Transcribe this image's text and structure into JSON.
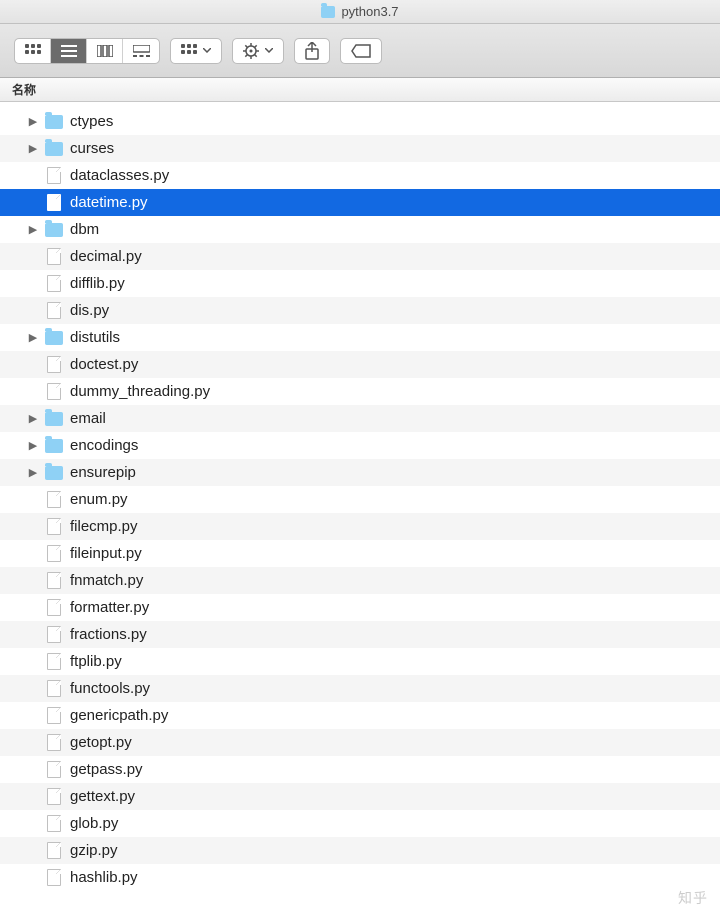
{
  "window": {
    "title": "python3.7"
  },
  "columns": {
    "name": "名称"
  },
  "watermark": "知乎",
  "items": [
    {
      "name": "",
      "type": "file",
      "expandable": false,
      "selected": false,
      "partial": true
    },
    {
      "name": "ctypes",
      "type": "folder",
      "expandable": true,
      "selected": false
    },
    {
      "name": "curses",
      "type": "folder",
      "expandable": true,
      "selected": false
    },
    {
      "name": "dataclasses.py",
      "type": "file",
      "expandable": false,
      "selected": false
    },
    {
      "name": "datetime.py",
      "type": "file",
      "expandable": false,
      "selected": true
    },
    {
      "name": "dbm",
      "type": "folder",
      "expandable": true,
      "selected": false
    },
    {
      "name": "decimal.py",
      "type": "file",
      "expandable": false,
      "selected": false
    },
    {
      "name": "difflib.py",
      "type": "file",
      "expandable": false,
      "selected": false
    },
    {
      "name": "dis.py",
      "type": "file",
      "expandable": false,
      "selected": false
    },
    {
      "name": "distutils",
      "type": "folder",
      "expandable": true,
      "selected": false
    },
    {
      "name": "doctest.py",
      "type": "file",
      "expandable": false,
      "selected": false
    },
    {
      "name": "dummy_threading.py",
      "type": "file",
      "expandable": false,
      "selected": false
    },
    {
      "name": "email",
      "type": "folder",
      "expandable": true,
      "selected": false
    },
    {
      "name": "encodings",
      "type": "folder",
      "expandable": true,
      "selected": false
    },
    {
      "name": "ensurepip",
      "type": "folder",
      "expandable": true,
      "selected": false
    },
    {
      "name": "enum.py",
      "type": "file",
      "expandable": false,
      "selected": false
    },
    {
      "name": "filecmp.py",
      "type": "file",
      "expandable": false,
      "selected": false
    },
    {
      "name": "fileinput.py",
      "type": "file",
      "expandable": false,
      "selected": false
    },
    {
      "name": "fnmatch.py",
      "type": "file",
      "expandable": false,
      "selected": false
    },
    {
      "name": "formatter.py",
      "type": "file",
      "expandable": false,
      "selected": false
    },
    {
      "name": "fractions.py",
      "type": "file",
      "expandable": false,
      "selected": false
    },
    {
      "name": "ftplib.py",
      "type": "file",
      "expandable": false,
      "selected": false
    },
    {
      "name": "functools.py",
      "type": "file",
      "expandable": false,
      "selected": false
    },
    {
      "name": "genericpath.py",
      "type": "file",
      "expandable": false,
      "selected": false
    },
    {
      "name": "getopt.py",
      "type": "file",
      "expandable": false,
      "selected": false
    },
    {
      "name": "getpass.py",
      "type": "file",
      "expandable": false,
      "selected": false
    },
    {
      "name": "gettext.py",
      "type": "file",
      "expandable": false,
      "selected": false
    },
    {
      "name": "glob.py",
      "type": "file",
      "expandable": false,
      "selected": false
    },
    {
      "name": "gzip.py",
      "type": "file",
      "expandable": false,
      "selected": false
    },
    {
      "name": "hashlib.py",
      "type": "file",
      "expandable": false,
      "selected": false
    }
  ]
}
